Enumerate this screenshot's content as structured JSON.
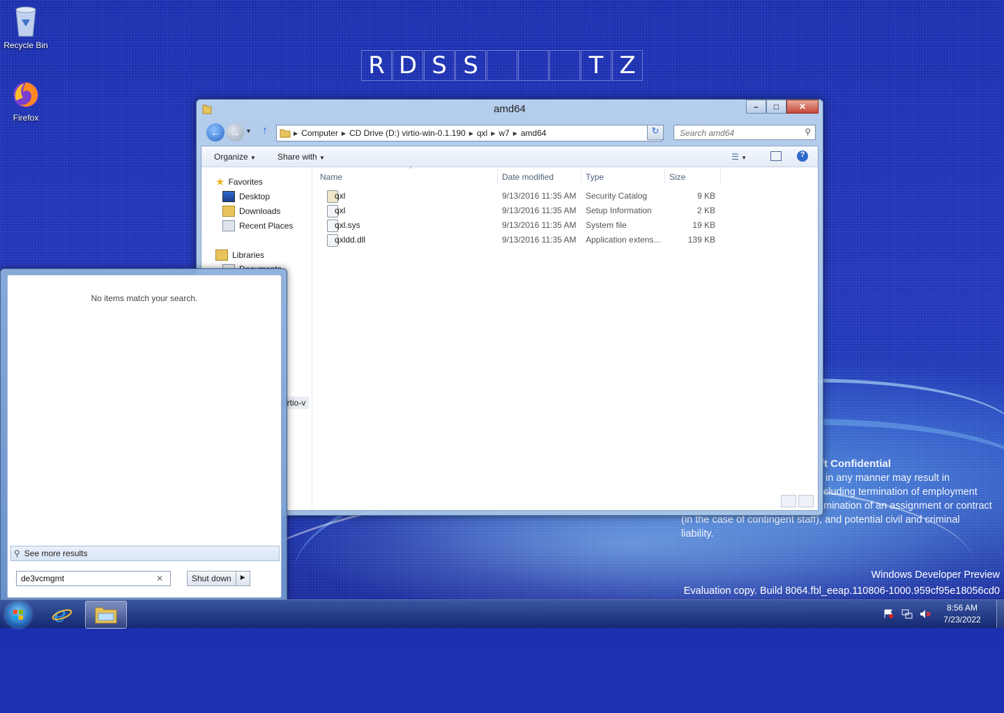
{
  "desktop": {
    "icons": [
      {
        "label": "Recycle Bin",
        "icon": "recycle-bin-icon"
      },
      {
        "label": "Firefox",
        "icon": "firefox-icon"
      }
    ],
    "tiles": [
      "R",
      "D",
      "S",
      "S",
      "",
      "",
      "",
      "T",
      "Z"
    ],
    "confidential": {
      "heading": "ft Confidential",
      "lines": [
        "in any manner may result in",
        "cluding termination of employment",
        "mination of an assignment or contract",
        "(in the case of contingent staff), and potential civil and criminal",
        "liability."
      ]
    },
    "watermark": {
      "line1": "Windows Developer Preview",
      "line2": "Evaluation copy. Build 8064.fbl_eeap.110806-1000.959cf95e18056cd0"
    }
  },
  "explorer": {
    "title": "amd64",
    "breadcrumb": [
      "Computer",
      "CD Drive (D:) virtio-win-0.1.190",
      "qxl",
      "w7",
      "amd64"
    ],
    "search_placeholder": "Search amd64",
    "toolbar": {
      "organize": "Organize",
      "share_with": "Share with"
    },
    "nav": {
      "favorites": "Favorites",
      "desktop": "Desktop",
      "downloads": "Downloads",
      "recent_places": "Recent Places",
      "libraries": "Libraries",
      "documents": "Documents",
      "partial_drive": "virtio-v"
    },
    "columns": {
      "name": "Name",
      "date_modified": "Date modified",
      "type": "Type",
      "size": "Size"
    },
    "files": [
      {
        "name": "qxl",
        "date": "9/13/2016 11:35 AM",
        "type": "Security Catalog",
        "size": "9 KB"
      },
      {
        "name": "qxl",
        "date": "9/13/2016 11:35 AM",
        "type": "Setup Information",
        "size": "2 KB"
      },
      {
        "name": "qxl.sys",
        "date": "9/13/2016 11:35 AM",
        "type": "System file",
        "size": "19 KB"
      },
      {
        "name": "qxldd.dll",
        "date": "9/13/2016 11:35 AM",
        "type": "Application extens...",
        "size": "139 KB"
      }
    ]
  },
  "start_menu": {
    "no_items": "No items match your search.",
    "see_more": "See more results",
    "search_value": "de3vcmgmt",
    "shutdown": "Shut down"
  },
  "taskbar": {
    "time": "8:56 AM",
    "date": "7/23/2022",
    "pinned": [
      "internet-explorer-icon",
      "windows-explorer-icon"
    ]
  }
}
